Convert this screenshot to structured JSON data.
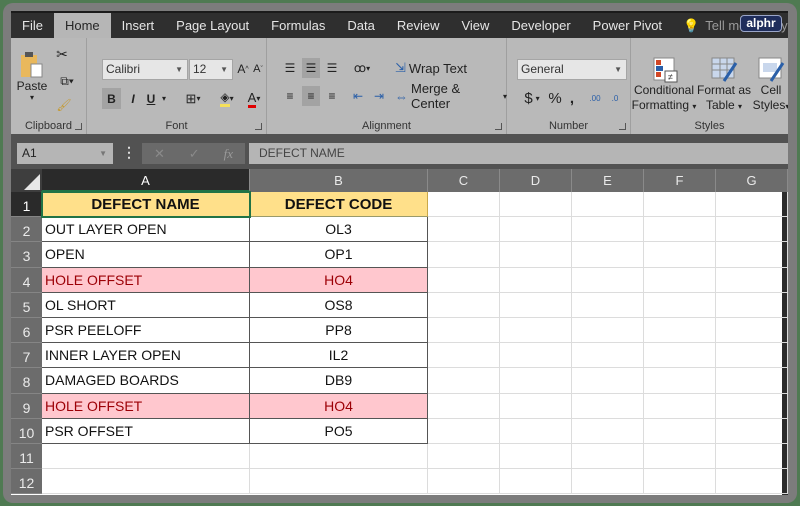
{
  "watermark": "alphr",
  "ribbon_tabs": [
    "File",
    "Home",
    "Insert",
    "Page Layout",
    "Formulas",
    "Data",
    "Review",
    "View",
    "Developer",
    "Power Pivot"
  ],
  "active_tab": "Home",
  "tell_me": "Tell me what you want to",
  "clipboard": {
    "paste": "Paste",
    "label": "Clipboard"
  },
  "font": {
    "name": "Calibri",
    "size": "12",
    "bold": "B",
    "italic": "I",
    "underline": "U",
    "label": "Font"
  },
  "alignment": {
    "wrap_text": "Wrap Text",
    "merge_center": "Merge & Center",
    "label": "Alignment"
  },
  "number": {
    "format": "General",
    "currency": "$",
    "percent": "%",
    "comma": ",",
    "inc_decimal": ".00",
    "dec_decimal": ".0",
    "label": "Number"
  },
  "styles": {
    "conditional_1": "Conditional",
    "conditional_2": "Formatting",
    "format_table_1": "Format as",
    "format_table_2": "Table",
    "cell_styles_1": "Cell",
    "cell_styles_2": "Styles",
    "label": "Styles"
  },
  "formula_bar": {
    "name_box": "A1",
    "fx": "fx",
    "content": "DEFECT NAME"
  },
  "columns": [
    "A",
    "B",
    "C",
    "D",
    "E",
    "F",
    "G"
  ],
  "rows": [
    "1",
    "2",
    "3",
    "4",
    "5",
    "6",
    "7",
    "8",
    "9",
    "10",
    "11",
    "12"
  ],
  "table": {
    "headers": [
      "DEFECT NAME",
      "DEFECT CODE"
    ],
    "rows": [
      {
        "name": "OUT LAYER OPEN",
        "code": "OL3",
        "duplicate": false
      },
      {
        "name": "OPEN",
        "code": "OP1",
        "duplicate": false
      },
      {
        "name": "HOLE OFFSET",
        "code": "HO4",
        "duplicate": true
      },
      {
        "name": "OL SHORT",
        "code": "OS8",
        "duplicate": false
      },
      {
        "name": "PSR PEELOFF",
        "code": "PP8",
        "duplicate": false
      },
      {
        "name": "INNER LAYER OPEN",
        "code": "IL2",
        "duplicate": false
      },
      {
        "name": "DAMAGED BOARDS",
        "code": "DB9",
        "duplicate": false
      },
      {
        "name": "HOLE OFFSET",
        "code": "HO4",
        "duplicate": true
      },
      {
        "name": "PSR OFFSET",
        "code": "PO5",
        "duplicate": false
      }
    ]
  },
  "colors": {
    "header_fill": "#ffe08a",
    "duplicate_fill": "#ffc7ce",
    "duplicate_text": "#9c0006",
    "selection": "#217346"
  }
}
